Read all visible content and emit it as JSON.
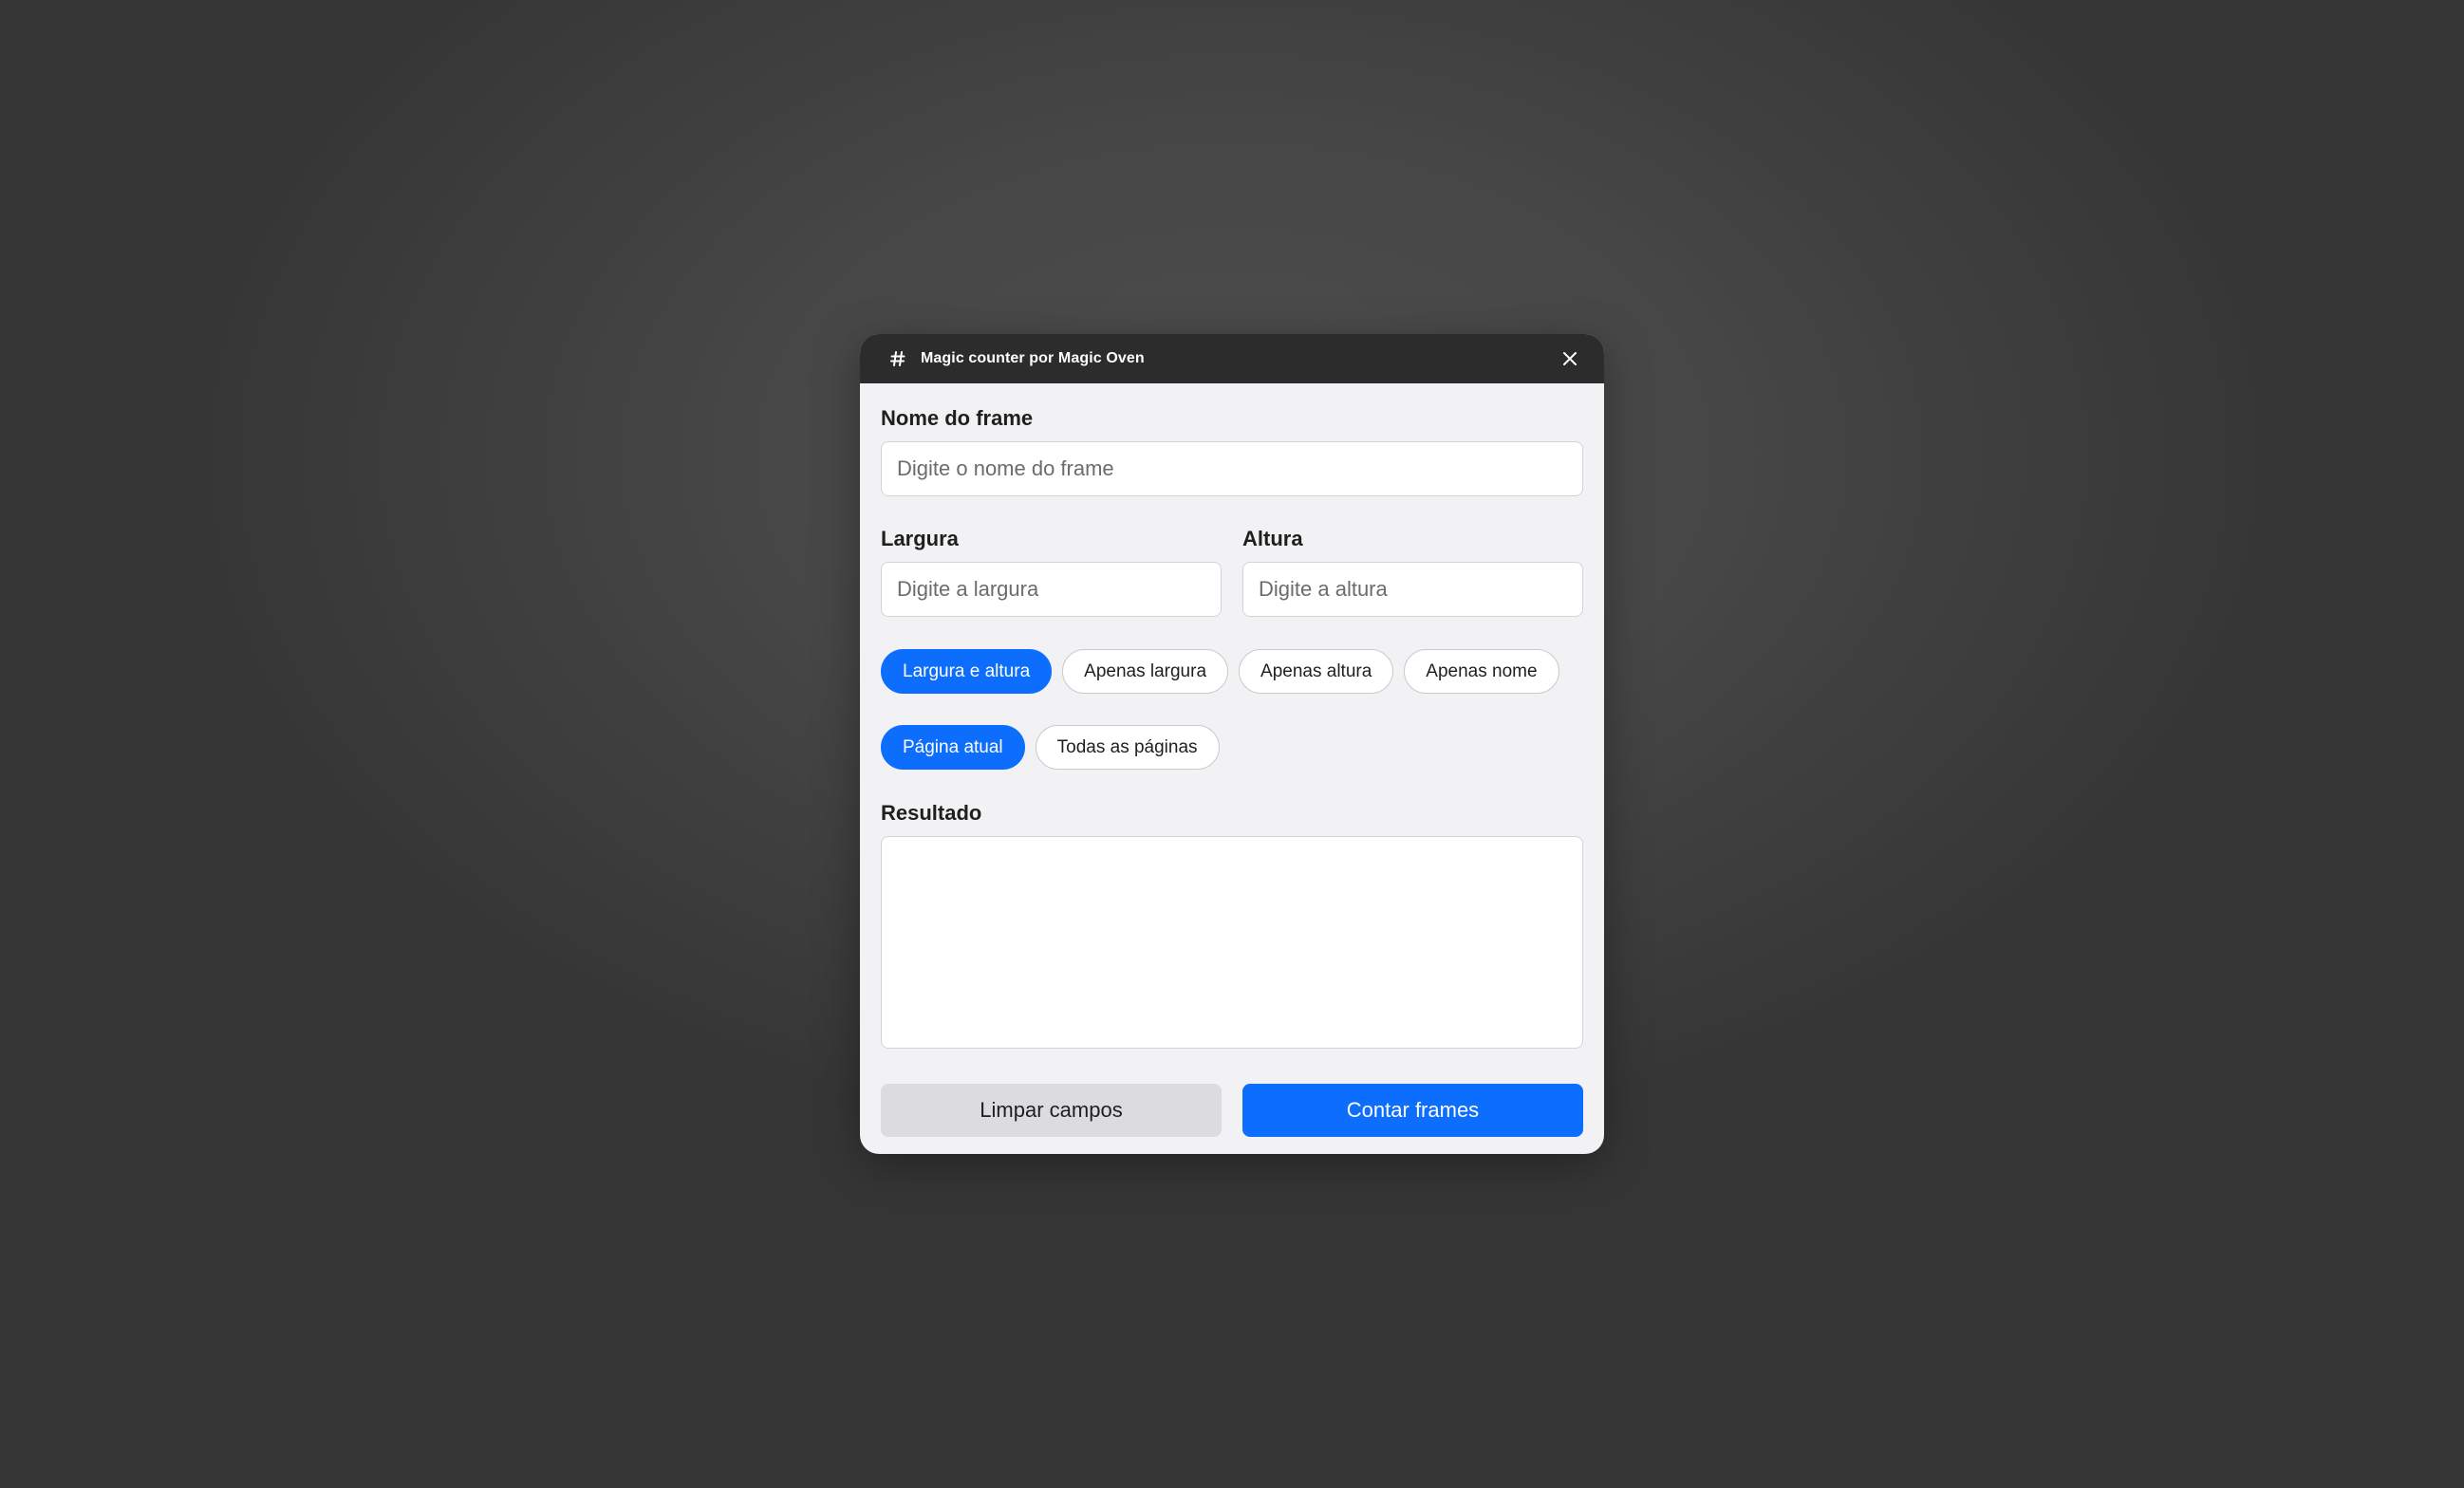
{
  "window": {
    "title": "Magic counter por Magic Oven",
    "app_icon": "hash-icon",
    "close_icon": "close-icon"
  },
  "form": {
    "frame_name": {
      "label": "Nome do frame",
      "placeholder": "Digite o nome do frame",
      "value": ""
    },
    "width": {
      "label": "Largura",
      "placeholder": "Digite a largura",
      "value": ""
    },
    "height": {
      "label": "Altura",
      "placeholder": "Digite a altura",
      "value": ""
    },
    "match_mode": {
      "options": [
        "Largura e altura",
        "Apenas largura",
        "Apenas altura",
        "Apenas nome"
      ],
      "selected": "Largura e altura"
    },
    "scope": {
      "options": [
        "Página atual",
        "Todas as páginas"
      ],
      "selected": "Página atual"
    },
    "result": {
      "label": "Resultado",
      "value": ""
    }
  },
  "actions": {
    "clear_label": "Limpar campos",
    "count_label": "Contar frames"
  },
  "colors": {
    "accent": "#0d6efd",
    "titlebar": "#2c2c2c",
    "panel": "#f2f2f4"
  }
}
